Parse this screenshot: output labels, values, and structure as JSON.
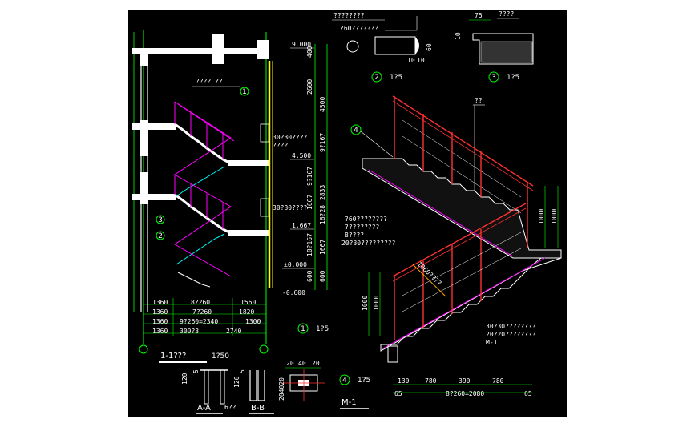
{
  "colors": {
    "page_bg": "#ffffff",
    "canvas_bg": "#000000",
    "green": "#00ff00",
    "white": "#ffffff",
    "yellow": "#ffff00",
    "magenta": "#ff00ff",
    "red": "#ff3030",
    "cyan": "#00ffff"
  },
  "section_elevations": [
    "9.000",
    "4.500",
    "1.667",
    "±0.000",
    "-0.600"
  ],
  "section_dims": [
    "400",
    "2600",
    "4500",
    "9?167",
    "9?167",
    "2833",
    "1667",
    "16?28",
    "10?167",
    "1667",
    "600",
    "600",
    "500"
  ],
  "section_callouts": {
    "top": "???? ??",
    "upper": "30?30????\n????",
    "lower": "30?30????"
  },
  "plan_rows": [
    {
      "left": "1360",
      "mid": "8?260",
      "right": "1560"
    },
    {
      "left": "1360",
      "mid": "7?260",
      "right": "1820"
    },
    {
      "left": "1360",
      "mid": "9?260=2340",
      "right": "1300"
    },
    {
      "left": "1360",
      "mid": "300?3",
      "right": "2740"
    }
  ],
  "section_title": "1-1???",
  "section_scale": "1?50",
  "detail1": {
    "number": "1",
    "scale": "1?5"
  },
  "detail2": {
    "number": "2",
    "scale": "1?5",
    "title": "????????",
    "label": "?60???????",
    "dims": [
      "10",
      "10",
      "60"
    ]
  },
  "detail3": {
    "number": "3",
    "scale": "1?5",
    "dim_top": "75",
    "label": "????",
    "dim_side": "10"
  },
  "detail4": {
    "number": "4",
    "scale": "1?5",
    "dims": [
      "20",
      "40",
      "20"
    ],
    "side": "204020"
  },
  "aa_label": "A-A",
  "aa_sub": "6??",
  "bb_label": "B-B",
  "aa_dims": [
    "120",
    "5",
    "120",
    "5"
  ],
  "iso": {
    "mark_top": "??",
    "balloon": "4",
    "note_left": "?60???????\n????????\n8????\n20?30?????????",
    "note_right": "30?30????????\n20?20????????\nM-1",
    "height_dims": [
      "1000",
      "1000",
      "1000",
      "1000"
    ],
    "bottom_dims": [
      "130",
      "780",
      "390",
      "780"
    ],
    "bottom_total": "8?260=2080",
    "bottom_ends": [
      "65",
      "65"
    ],
    "rail_text": "1060????"
  },
  "m1_label": "M-1"
}
